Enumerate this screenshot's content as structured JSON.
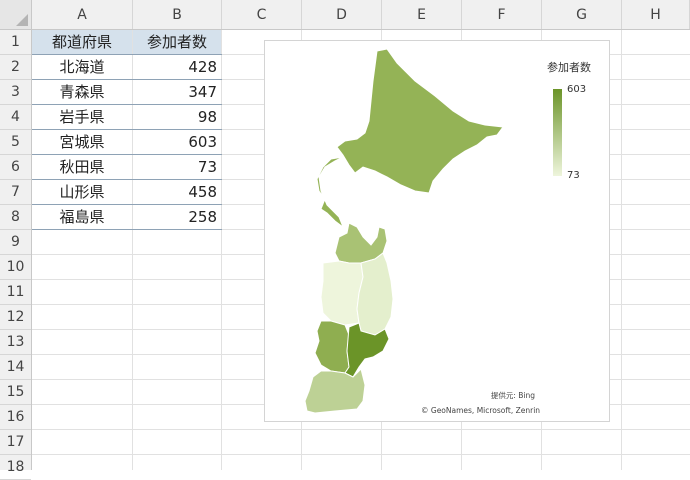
{
  "columns": [
    "A",
    "B",
    "C",
    "D",
    "E",
    "F",
    "G",
    "H"
  ],
  "rows": [
    "1",
    "2",
    "3",
    "4",
    "5",
    "6",
    "7",
    "8",
    "9",
    "10",
    "11",
    "12",
    "13",
    "14",
    "15",
    "16",
    "17",
    "18"
  ],
  "table": {
    "header": [
      "都道府県",
      "参加者数"
    ],
    "rows": [
      {
        "pref": "北海道",
        "count": "428"
      },
      {
        "pref": "青森県",
        "count": "347"
      },
      {
        "pref": "岩手県",
        "count": "98"
      },
      {
        "pref": "宮城県",
        "count": "603"
      },
      {
        "pref": "秋田県",
        "count": "73"
      },
      {
        "pref": "山形県",
        "count": "458"
      },
      {
        "pref": "福島県",
        "count": "258"
      }
    ]
  },
  "map_chart": {
    "legend_title": "参加者数",
    "legend_max": "603",
    "legend_min": "73",
    "color_max": "#6b9428",
    "color_min": "#eef5dc",
    "attribution_line1": "提供元: Bing",
    "attribution_line2": "© GeoNames, Microsoft, Zenrin"
  },
  "colors": {
    "header_fill": "#d5e1ec",
    "hokkaido": "#94b356",
    "aomori": "#a9c274",
    "iwate": "#e4efcd",
    "miyagi": "#6b9428",
    "akita": "#eef5dc",
    "yamagata": "#8fae50",
    "fukushima": "#bdd195"
  }
}
